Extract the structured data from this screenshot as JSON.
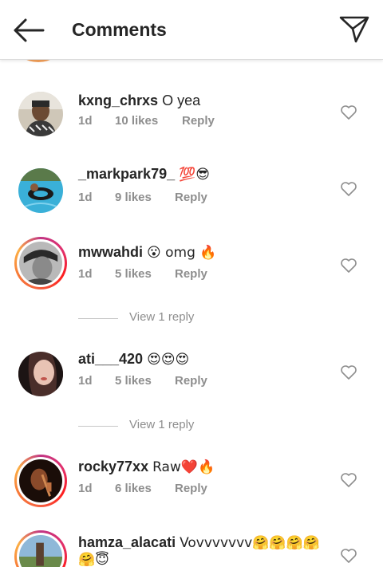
{
  "header": {
    "title": "Comments",
    "back_icon": "arrow-left-icon",
    "send_icon": "paper-plane-icon"
  },
  "comments": [
    {
      "username": "kxng_chrxs",
      "text": "O yea",
      "age": "1d",
      "likes": "10 likes",
      "reply": "Reply"
    },
    {
      "username": "_markpark79_",
      "text": "💯😎",
      "age": "1d",
      "likes": "9 likes",
      "reply": "Reply"
    },
    {
      "username": "mwwahdi",
      "text": "😮 omg 🔥",
      "age": "1d",
      "likes": "5 likes",
      "reply": "Reply",
      "view_replies": "View 1 reply"
    },
    {
      "username": "ati___420",
      "text": "😍😍😍",
      "age": "1d",
      "likes": "5 likes",
      "reply": "Reply",
      "view_replies": "View 1 reply"
    },
    {
      "username": "rocky77xx",
      "text": "Raw❤️🔥",
      "age": "1d",
      "likes": "6 likes",
      "reply": "Reply"
    },
    {
      "username": "hamza_alacati",
      "text": "Vovvvvvvv🤗🤗🤗🤗",
      "text2": "🤗😇"
    }
  ],
  "colors": {
    "story_ring": "#e1306c",
    "meta_text": "#8e8e8e",
    "text": "#262626"
  }
}
